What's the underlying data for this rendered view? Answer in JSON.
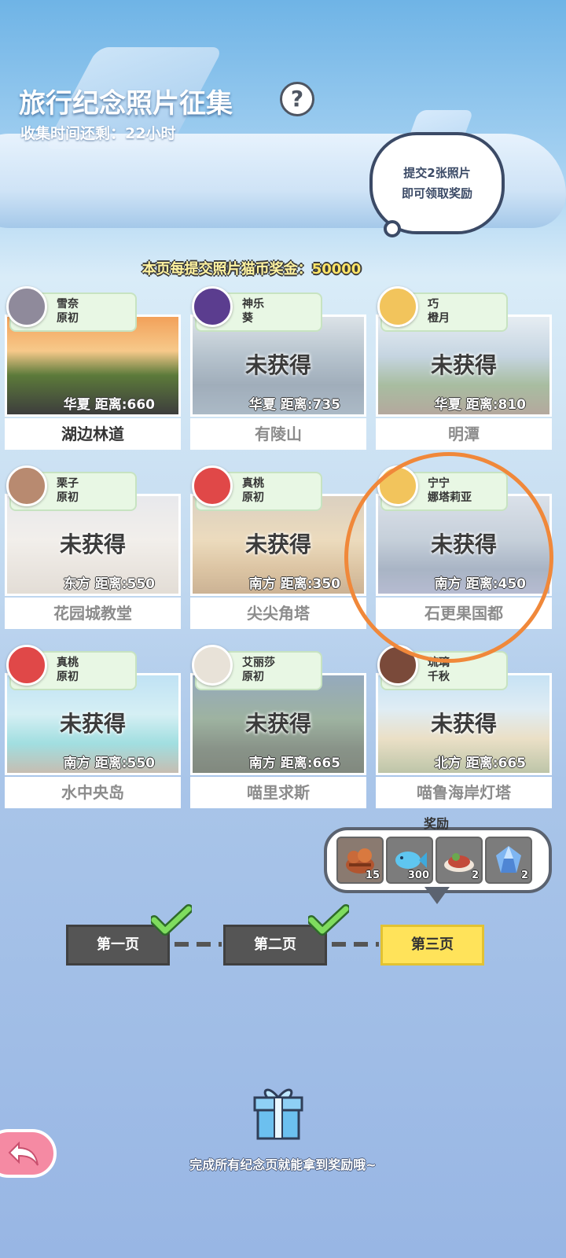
{
  "header": {
    "title": "旅行纪念照片征集",
    "help_icon": "question-mark-icon",
    "time_left": "收集时间还剩：22小时",
    "bubble_line1": "提交2张照片",
    "bubble_line2": "即可领取奖励",
    "bonus_prefix": "本页每提交照片猫币奖金：",
    "bonus_value": "50000"
  },
  "unobtained_label": "未获得",
  "cards": [
    {
      "char_line1": "雪奈",
      "char_line2": "原初",
      "region": "华夏",
      "distance": "距离:660",
      "name": "湖边林道",
      "obtained": true,
      "avatar_color": "#8f8a9b"
    },
    {
      "char_line1": "神乐",
      "char_line2": "葵",
      "region": "华夏",
      "distance": "距离:735",
      "name": "有陵山",
      "obtained": false,
      "avatar_color": "#5b3d8f"
    },
    {
      "char_line1": "巧",
      "char_line2": "橙月",
      "region": "华夏",
      "distance": "距离:810",
      "name": "明潭",
      "obtained": false,
      "avatar_color": "#f2c45c"
    },
    {
      "char_line1": "栗子",
      "char_line2": "原初",
      "region": "东方",
      "distance": "距离:550",
      "name": "花园城教堂",
      "obtained": false,
      "avatar_color": "#b88a70"
    },
    {
      "char_line1": "真桃",
      "char_line2": "原初",
      "region": "南方",
      "distance": "距离:350",
      "name": "尖尖角塔",
      "obtained": false,
      "avatar_color": "#e04848"
    },
    {
      "char_line1": "宁宁",
      "char_line2": "娜塔莉亚",
      "region": "南方",
      "distance": "距离:450",
      "name": "石更果国都",
      "obtained": false,
      "avatar_color": "#f2c45c"
    },
    {
      "char_line1": "真桃",
      "char_line2": "原初",
      "region": "南方",
      "distance": "距离:550",
      "name": "水中央岛",
      "obtained": false,
      "avatar_color": "#e04848"
    },
    {
      "char_line1": "艾丽莎",
      "char_line2": "原初",
      "region": "南方",
      "distance": "距离:665",
      "name": "喵里求斯",
      "obtained": false,
      "avatar_color": "#e8e2d8"
    },
    {
      "char_line1": "琉璃",
      "char_line2": "千秋",
      "region": "北方",
      "distance": "距离:665",
      "name": "喵鲁海岸灯塔",
      "obtained": false,
      "avatar_color": "#7a4a3a"
    }
  ],
  "rewards": {
    "title": "奖励",
    "items": [
      {
        "icon": "food-basket-icon",
        "count": "15"
      },
      {
        "icon": "blue-fish-icon",
        "count": "300"
      },
      {
        "icon": "cooked-dish-icon",
        "count": "2"
      },
      {
        "icon": "blue-crystal-icon",
        "count": "2"
      }
    ]
  },
  "pages": [
    {
      "label": "第一页",
      "completed": true
    },
    {
      "label": "第二页",
      "completed": true
    },
    {
      "label": "第三页",
      "completed": false,
      "active": true
    }
  ],
  "footer": {
    "text": "完成所有纪念页就能拿到奖励哦~",
    "gift_icon": "gift-box-icon",
    "back_icon": "back-arrow-icon"
  },
  "colors": {
    "highlight_circle": "#f0883a",
    "active_page": "#ffe35a",
    "inactive_page": "#555555",
    "tag_bg": "#e8f7e4"
  }
}
